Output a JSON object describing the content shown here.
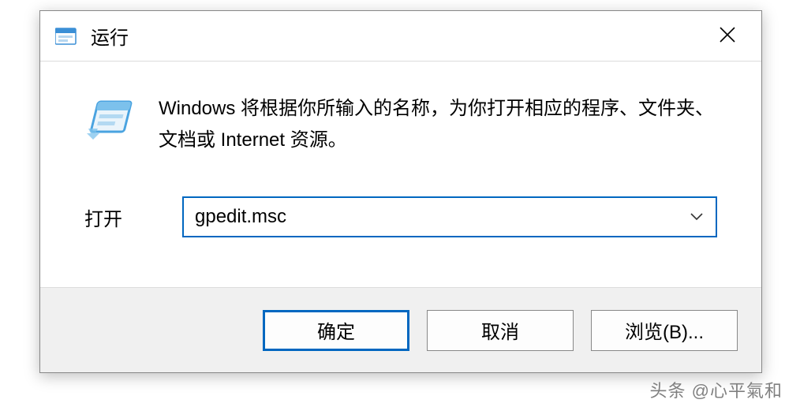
{
  "titlebar": {
    "title": "运行"
  },
  "body": {
    "description": "Windows 将根据你所输入的名称，为你打开相应的程序、文件夹、文档或 Internet 资源。",
    "open_label": "打开",
    "open_value": "gpedit.msc"
  },
  "footer": {
    "ok_label": "确定",
    "cancel_label": "取消",
    "browse_label": "浏览(B)..."
  },
  "watermark": "头条 @心平氣和"
}
